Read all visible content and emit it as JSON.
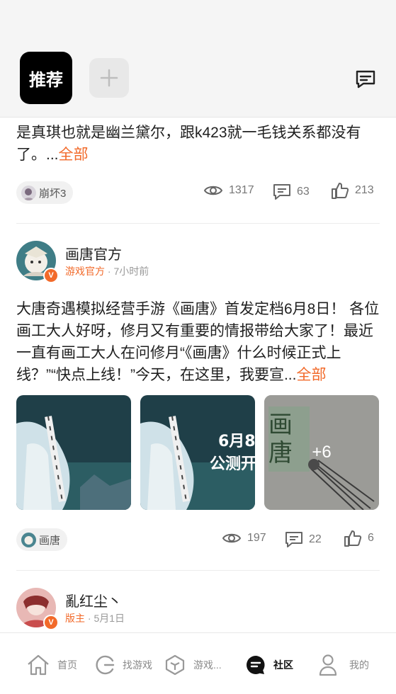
{
  "header": {
    "active_tab": "推荐",
    "add_tab": "+"
  },
  "post1": {
    "text_tail": "是真琪也就是幽兰黛尔，跟k423就一毛钱关系都没有了。...",
    "more": "全部",
    "tag": "崩坏3",
    "views": "1317",
    "comments": "63",
    "likes": "213"
  },
  "post2": {
    "author": "画唐官方",
    "role": "游戏官方",
    "time": " · 7小时前",
    "text": "大唐奇遇模拟经营手游《画唐》首发定档6月8日！ 各位画工大人好呀，修月又有重要的情报带给大家了！最近一直有画工大人在问修月“《画唐》什么时候正式上线？”“快点上线！”今天，在这里，我要宣...",
    "more": "全部",
    "image2_text_line1": "6月8",
    "image2_text_line2": "公测开",
    "image3_logo": "画唐",
    "more_images": "+6",
    "tag": "画唐",
    "views": "197",
    "comments": "22",
    "likes": "6"
  },
  "post3": {
    "author": "亂红尘丶",
    "role": "版主",
    "time": " · 5月1日"
  },
  "nav": {
    "items": [
      "首页",
      "找游戏",
      "游戏...",
      "社区",
      "我的"
    ]
  },
  "colors": {
    "accent": "#f26a2a",
    "active_tab_bg": "#000000",
    "topbar_bg": "#f5f5f5"
  }
}
